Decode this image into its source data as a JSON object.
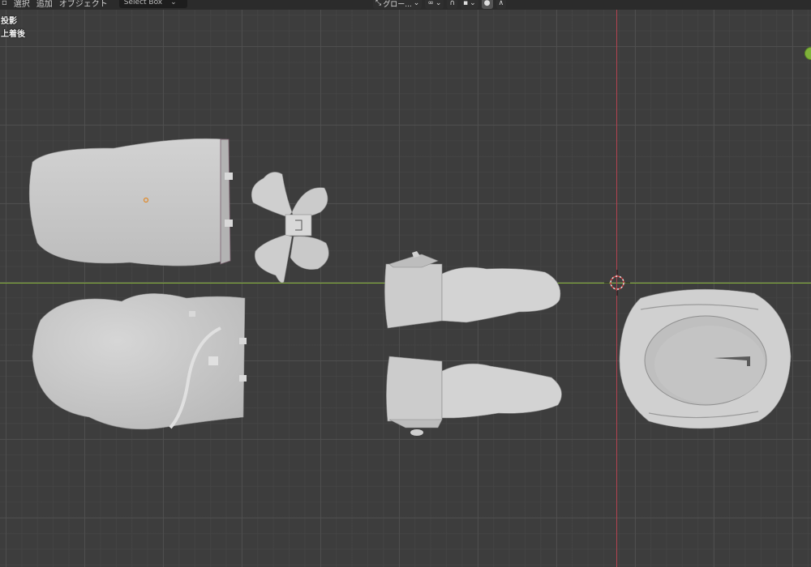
{
  "header": {
    "menu_select": "選択",
    "menu_add": "追加",
    "menu_object": "オブジェクト",
    "select_mode": "Select Box",
    "transform_orientation": "グロー...",
    "chevron": "⌄"
  },
  "overlay": {
    "projection": "投影",
    "view_name": "上着後"
  },
  "colors": {
    "background": "#3d3d3d",
    "mesh": "#c8c8c8",
    "x_axis": "#86b33a",
    "y_axis": "#b54350",
    "origin": "#e08a2a"
  }
}
